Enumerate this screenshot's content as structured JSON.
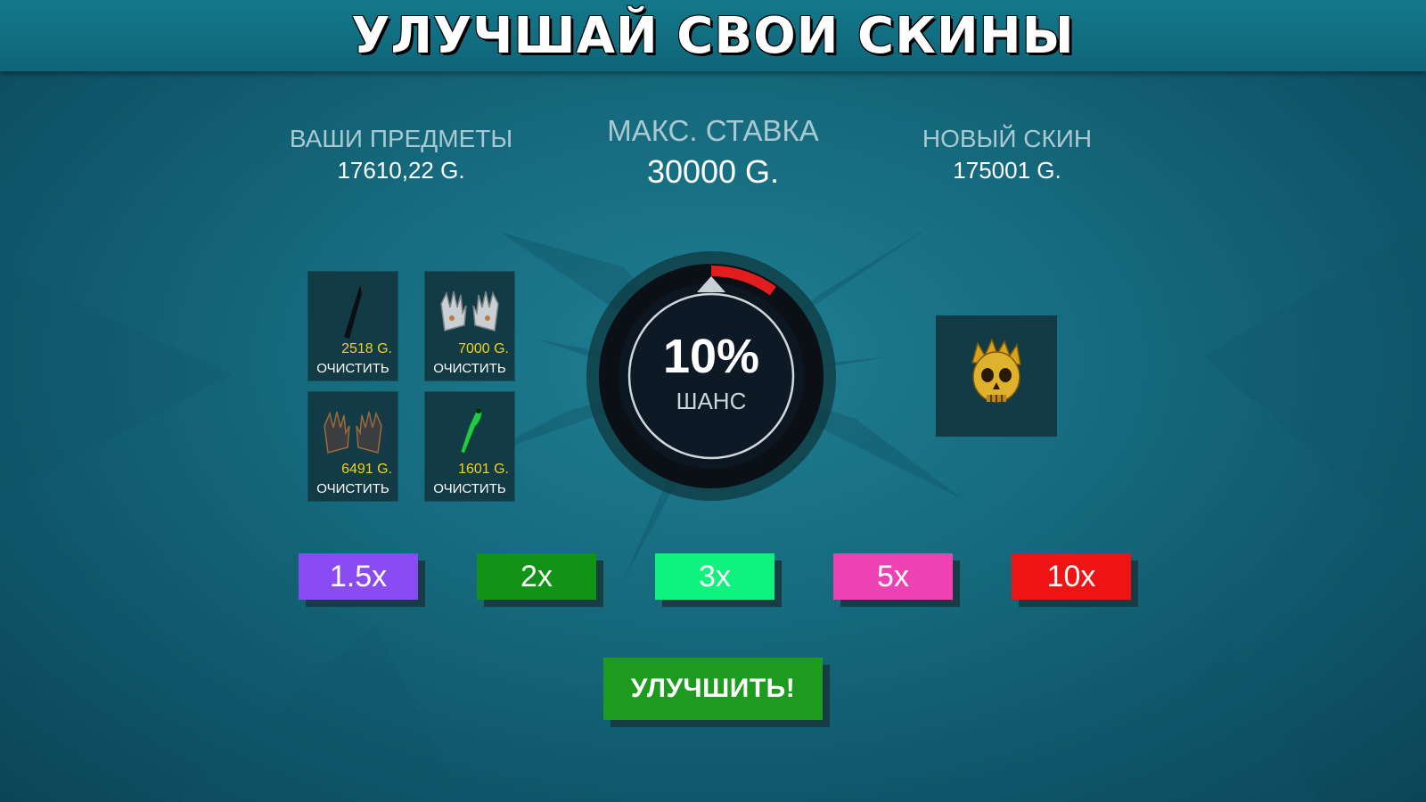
{
  "header": {
    "title": "УЛУЧШАЙ СВОИ СКИНЫ"
  },
  "stats": {
    "your_items": {
      "label": "ВАШИ ПРЕДМЕТЫ",
      "value": "17610,22 G."
    },
    "max_bet": {
      "label": "МАКС. СТАВКА",
      "value": "30000 G."
    },
    "new_skin": {
      "label": "НОВЫЙ СКИН",
      "value": "175001 G."
    }
  },
  "items": [
    {
      "icon": "black-knife-icon",
      "price": "2518 G.",
      "clear_label": "ОЧИСТИТЬ"
    },
    {
      "icon": "silver-gloves-icon",
      "price": "7000 G.",
      "clear_label": "ОЧИСТИТЬ"
    },
    {
      "icon": "dark-gloves-icon",
      "price": "6491 G.",
      "clear_label": "ОЧИСТИТЬ"
    },
    {
      "icon": "green-knife-icon",
      "price": "1601 G.",
      "clear_label": "ОЧИСТИТЬ"
    }
  ],
  "wheel": {
    "chance": "10%",
    "chance_label": "ШАНС",
    "chance_fraction": 0.1,
    "arc_color": "#e21d1d"
  },
  "target_skin": {
    "icon": "golden-skull-icon"
  },
  "multipliers": [
    {
      "label": "1.5x",
      "color": "#8a4cf2"
    },
    {
      "label": "2x",
      "color": "#119416"
    },
    {
      "label": "3x",
      "color": "#0ff27d"
    },
    {
      "label": "5x",
      "color": "#ee41b4"
    },
    {
      "label": "10x",
      "color": "#f01313"
    }
  ],
  "upgrade_button": {
    "label": "УЛУЧШИТЬ!"
  }
}
